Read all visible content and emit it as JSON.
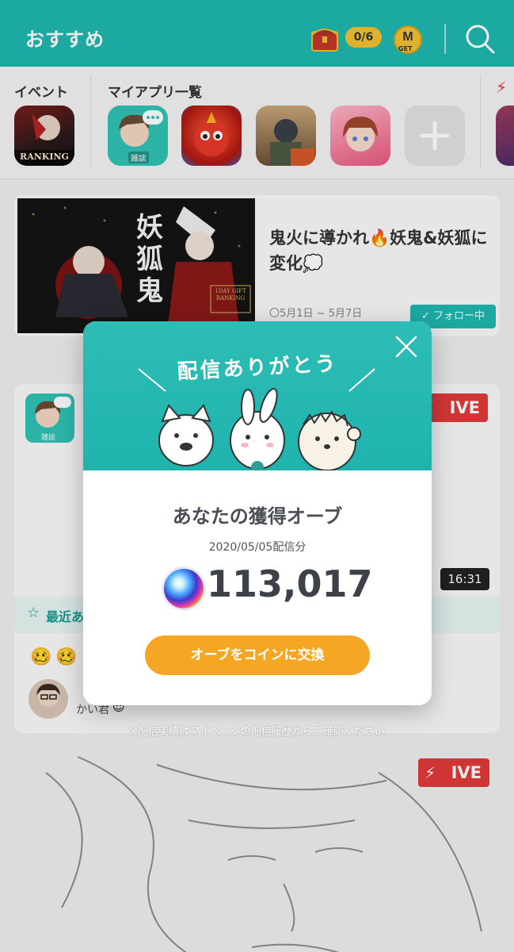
{
  "header": {
    "title": "おすすめ",
    "quest_counter": "0/6",
    "mget_label": "GET"
  },
  "strip": {
    "event_label": "イベント",
    "myapps_label": "マイアプリ一覧",
    "event_icon_text": "RANKING",
    "chat_icon_tag": "雑談"
  },
  "event_card": {
    "title": "鬼火に導かれ🔥妖鬼&妖狐に変化💭",
    "date": "〇5月1日 ~ 5月7日",
    "thumb_caption": "1DAY GIFT RANKING"
  },
  "live_card": {
    "live_label": "IVE",
    "duration": "16:31",
    "recent_label": "最近あ",
    "follow_label": "フォロー中",
    "streamer_name": "かい君",
    "avatar_tag": "雑談"
  },
  "card2": {
    "live_label": "IVE"
  },
  "modal": {
    "heading": "配信ありがとう",
    "orb_title": "あなたの獲得オーブ",
    "date": "2020/05/05配信分",
    "orb_value": "113,017",
    "exchange_button": "オーブをコインに交換"
  },
  "footnote": "※配信実績はマイページの配信履歴からご確認ください",
  "colors": {
    "brand_teal": "#1fb8b0",
    "orange_button": "#f5a623",
    "live_red": "#e23a3a"
  }
}
